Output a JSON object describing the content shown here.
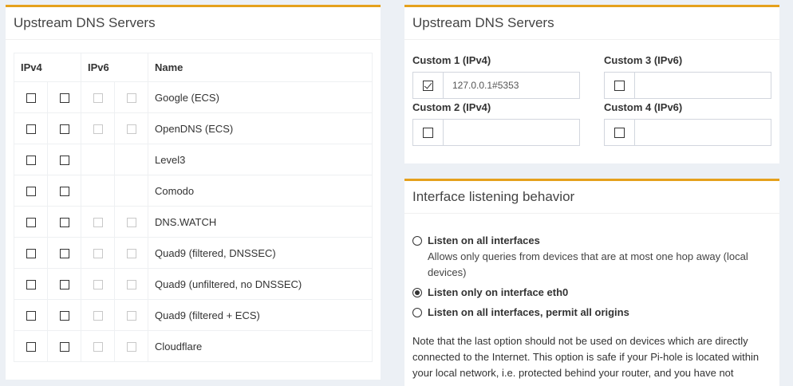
{
  "upstream": {
    "title": "Upstream DNS Servers",
    "headers": {
      "ipv4": "IPv4",
      "ipv6": "IPv6",
      "name": "Name"
    },
    "rows": [
      {
        "name": "Google (ECS)",
        "ipv6": true
      },
      {
        "name": "OpenDNS (ECS)",
        "ipv6": true
      },
      {
        "name": "Level3",
        "ipv6": false
      },
      {
        "name": "Comodo",
        "ipv6": false
      },
      {
        "name": "DNS.WATCH",
        "ipv6": true
      },
      {
        "name": "Quad9 (filtered, DNSSEC)",
        "ipv6": true
      },
      {
        "name": "Quad9 (unfiltered, no DNSSEC)",
        "ipv6": true
      },
      {
        "name": "Quad9 (filtered + ECS)",
        "ipv6": true
      },
      {
        "name": "Cloudflare",
        "ipv6": true
      }
    ]
  },
  "custom": {
    "title": "Upstream DNS Servers",
    "c1": {
      "label": "Custom 1 (IPv4)",
      "value": "127.0.0.1#5353",
      "checked": true
    },
    "c2": {
      "label": "Custom 2 (IPv4)",
      "value": "",
      "checked": false
    },
    "c3": {
      "label": "Custom 3 (IPv6)",
      "value": "",
      "checked": false
    },
    "c4": {
      "label": "Custom 4 (IPv6)",
      "value": "",
      "checked": false
    }
  },
  "interface": {
    "title": "Interface listening behavior",
    "opt1": "Listen on all interfaces",
    "opt1_desc": "Allows only queries from devices that are at most one hop away (local devices)",
    "opt2": "Listen only on interface eth0",
    "opt3": "Listen on all interfaces, permit all origins",
    "note": "Note that the last option should not be used on devices which are directly connected to the Internet. This option is safe if your Pi-hole is located within your local network, i.e. protected behind your router, and you have not"
  }
}
